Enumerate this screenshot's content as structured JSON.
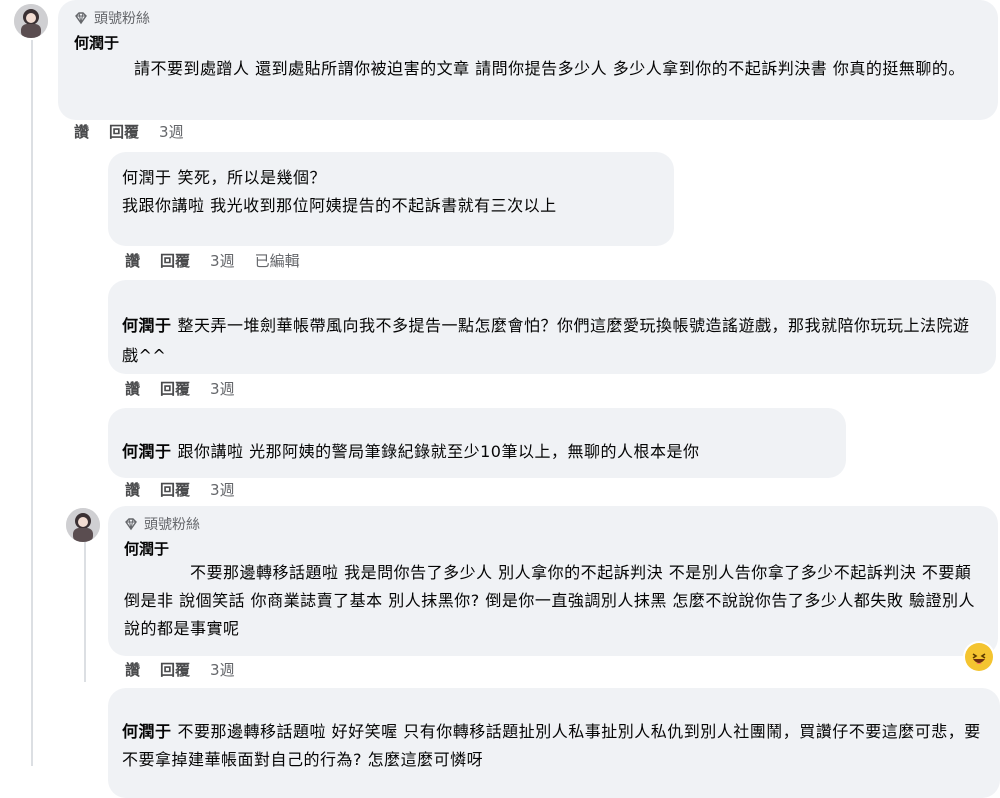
{
  "comments": [
    {
      "badge": "頭號粉絲",
      "author": "何潤于",
      "text": "請不要到處蹭人 還到處貼所謂你被迫害的文章 請問你提告多少人 多少人拿到你的不起訴判決書 你真的挺無聊的。",
      "actions": {
        "like": "讚",
        "reply": "回覆",
        "time": "3週"
      }
    },
    {
      "mention": "何潤于",
      "line1": "笑死，所以是幾個？",
      "line2": "我跟你講啦 我光收到那位阿姨提告的不起訴書就有三次以上",
      "actions": {
        "like": "讚",
        "reply": "回覆",
        "time": "3週",
        "edited": "已編輯"
      }
    },
    {
      "mention": "何潤于",
      "text": "整天弄一堆劍華帳帶風向我不多提告一點怎麼會怕？你們這麼愛玩換帳號造謠遊戲，那我就陪你玩玩上法院遊戲^^",
      "actions": {
        "like": "讚",
        "reply": "回覆",
        "time": "3週"
      }
    },
    {
      "mention": "何潤于",
      "text": "跟你講啦 光那阿姨的警局筆錄紀錄就至少10筆以上，無聊的人根本是你",
      "actions": {
        "like": "讚",
        "reply": "回覆",
        "time": "3週"
      }
    },
    {
      "badge": "頭號粉絲",
      "author": "何潤于",
      "text": "不要那邊轉移話題啦 我是問你告了多少人 別人拿你的不起訴判決 不是別人告你拿了多少不起訴判決 不要顛倒是非 說個笑話 你商業誌賣了基本 別人抹黑你? 倒是你一直強調別人抹黑 怎麼不說說你告了多少人都失敗 驗證別人說的都是事實呢",
      "actions": {
        "like": "讚",
        "reply": "回覆",
        "time": "3週"
      }
    },
    {
      "mention": "何潤于",
      "text": "不要那邊轉移話題啦 好好笑喔 只有你轉移話題扯別人私事扯別人私仇到別人社團鬧，買讚仔不要這麼可悲，要不要拿掉建華帳面對自己的行為? 怎麼這麼可憐呀"
    }
  ],
  "icons": {
    "badge": "diamond-icon",
    "reaction": "laughing-emoji-icon"
  },
  "colors": {
    "bubble": "#f0f2f5",
    "meta": "#65676b",
    "line": "#dcdfe3"
  }
}
